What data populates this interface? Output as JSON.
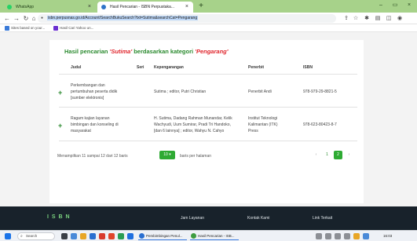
{
  "browser": {
    "tabs": [
      {
        "title": "WhatsApp"
      },
      {
        "title": "Hasil Pencarian - ISBN Perpustaka..."
      }
    ],
    "new_tab": "+",
    "url": "isbn.perpusnas.go.id/Account/SearchBukuSearch?txt=Sutima&searchCat=Pengarang",
    "bookmarks": [
      {
        "label": "Sites based on your..."
      },
      {
        "label": "Hasil Cari Yahoo un..."
      }
    ],
    "colors": {
      "tabbar": "#a7d28a"
    }
  },
  "page": {
    "heading": {
      "prefix": "Hasil pencarian",
      "query": "'Sutima'",
      "middle": "berdasarkan kategori",
      "category": "'Pengarang'"
    },
    "table": {
      "columns": [
        "Judul",
        "Seri",
        "Kepengarangan",
        "Penerbit",
        "ISBN"
      ],
      "rows": [
        {
          "title_lines": [
            "Perkembangan dan",
            "pertumbuhan peserta didik",
            "[sumber elektronis]"
          ],
          "series": "",
          "authors_lines": [
            "Sutima ; editor, Putri Christian"
          ],
          "publisher_lines": [
            "Penerbit Andi"
          ],
          "isbn": "978-979-29-8821-5"
        },
        {
          "title_lines": [
            "Ragam kajian layanan",
            "bimbingan dan konseling di",
            "masyarakat"
          ],
          "series": "",
          "authors_lines": [
            "H. Sutima, Dadang Rahman Munandar, Kelik",
            "Wachyudi, Uum Sumirar, Pradi Tri Handoko,",
            "[dan 6 lainnya] ; editor, Wahyu N. Cahyo"
          ],
          "publisher_lines": [
            "Institut Teknologi",
            "Kalimantan (ITK)",
            "Press"
          ],
          "isbn": "978-623-80423-8-7"
        }
      ]
    },
    "pagination": {
      "info": "Menampilkan 11 sampai 12 dari 12 baris",
      "per_page": "10",
      "per_page_label": "baris per halaman",
      "prev": "‹",
      "pages": [
        "1",
        "2"
      ],
      "active_page": "2",
      "next": "›"
    },
    "colors": {
      "accent": "#2a8a2e",
      "query": "#e0262d",
      "button": "#2eaa33"
    }
  },
  "footer": {
    "logo": "I S B N",
    "columns": [
      {
        "label": "Jam Layanan"
      },
      {
        "label": "Kontak Kami"
      },
      {
        "label": "Link Terkait"
      }
    ]
  },
  "taskbar": {
    "search_placeholder": "Search",
    "apps": [
      {
        "label": "Pembimbingan Penul..."
      },
      {
        "label": "Hasil Pencarian - ISB..."
      }
    ],
    "clock": "16:03"
  }
}
